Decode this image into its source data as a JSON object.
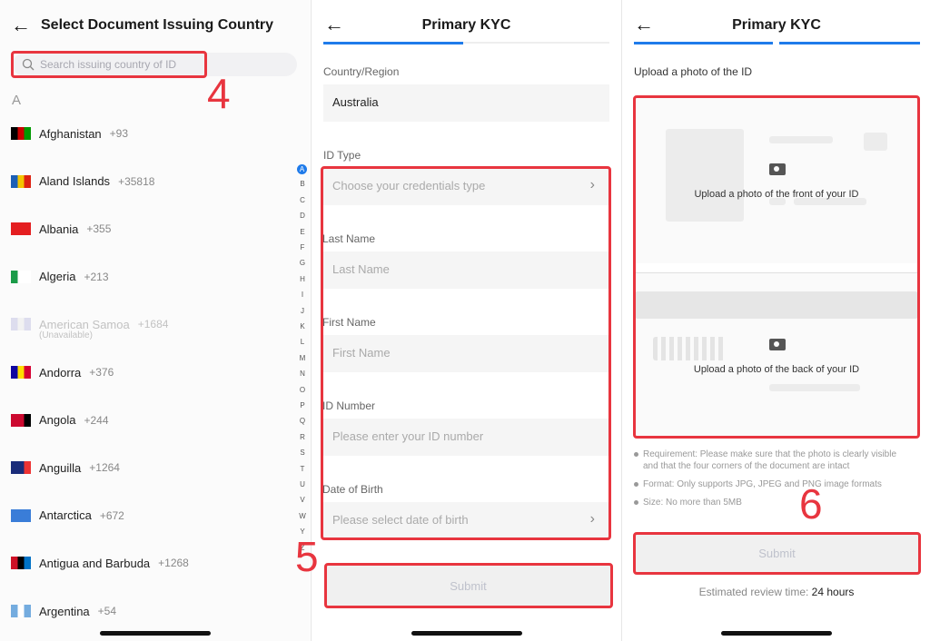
{
  "country_screen": {
    "title": "Select Document Issuing Country",
    "search_placeholder": "Search issuing country of ID",
    "section": "A",
    "countries": [
      {
        "name": "Afghanistan",
        "code": "+93",
        "colors": [
          "#000",
          "#c00",
          "#090"
        ]
      },
      {
        "name": "Aland Islands",
        "code": "+35818",
        "colors": [
          "#1d5fb5",
          "#f4c400",
          "#d21"
        ]
      },
      {
        "name": "Albania",
        "code": "+355",
        "colors": [
          "#e41e20",
          "#e41e20",
          "#e41e20"
        ]
      },
      {
        "name": "Algeria",
        "code": "+213",
        "colors": [
          "#1a9b48",
          "#fff",
          "#fff"
        ]
      },
      {
        "name": "American Samoa",
        "code": "+1684",
        "note": "(Unavailable)",
        "colors": [
          "#dde",
          "#f2f2f2",
          "#dde"
        ]
      },
      {
        "name": "Andorra",
        "code": "+376",
        "colors": [
          "#10069f",
          "#fedd00",
          "#d50032"
        ]
      },
      {
        "name": "Angola",
        "code": "+244",
        "colors": [
          "#cc092f",
          "#cc092f",
          "#000"
        ]
      },
      {
        "name": "Anguilla",
        "code": "+1264",
        "colors": [
          "#1a2c7a",
          "#1a2c7a",
          "#e33"
        ]
      },
      {
        "name": "Antarctica",
        "code": "+672",
        "colors": [
          "#3a7dd8",
          "#3a7dd8",
          "#3a7dd8"
        ]
      },
      {
        "name": "Antigua and Barbuda",
        "code": "+1268",
        "colors": [
          "#ce1126",
          "#000",
          "#0072c6"
        ]
      },
      {
        "name": "Argentina",
        "code": "+54",
        "colors": [
          "#74acdf",
          "#fff",
          "#74acdf"
        ]
      }
    ],
    "index": [
      "A",
      "B",
      "C",
      "D",
      "E",
      "F",
      "G",
      "H",
      "I",
      "J",
      "K",
      "L",
      "M",
      "N",
      "O",
      "P",
      "Q",
      "R",
      "S",
      "T",
      "U",
      "V",
      "W",
      "Y",
      "Z"
    ],
    "annotation": "4"
  },
  "kyc_form": {
    "title": "Primary KYC",
    "country_label": "Country/Region",
    "country_value": "Australia",
    "fields": [
      {
        "label": "ID Type",
        "placeholder": "Choose your credentials type",
        "chevron": true
      },
      {
        "label": "Last Name",
        "placeholder": "Last Name"
      },
      {
        "label": "First Name",
        "placeholder": "First Name"
      },
      {
        "label": "ID Number",
        "placeholder": "Please enter your ID number"
      },
      {
        "label": "Date of Birth",
        "placeholder": "Please select date of birth",
        "chevron": true
      }
    ],
    "submit": "Submit",
    "annotation": "5",
    "step": 1
  },
  "kyc_upload": {
    "title": "Primary KYC",
    "heading": "Upload a photo of the ID",
    "front": "Upload a photo of the front of your ID",
    "back": "Upload a photo of the back of your ID",
    "notes": [
      "Requirement: Please make sure that the photo is clearly visible and that the four corners of the document are intact",
      "Format: Only supports JPG, JPEG and PNG image formats",
      "Size: No more than 5MB"
    ],
    "submit": "Submit",
    "review_label": "Estimated review time:",
    "review_value": "24 hours",
    "annotation": "6",
    "step": 2
  },
  "colors": {
    "accent": "#1f7bea",
    "annotation": "#e8353f"
  }
}
